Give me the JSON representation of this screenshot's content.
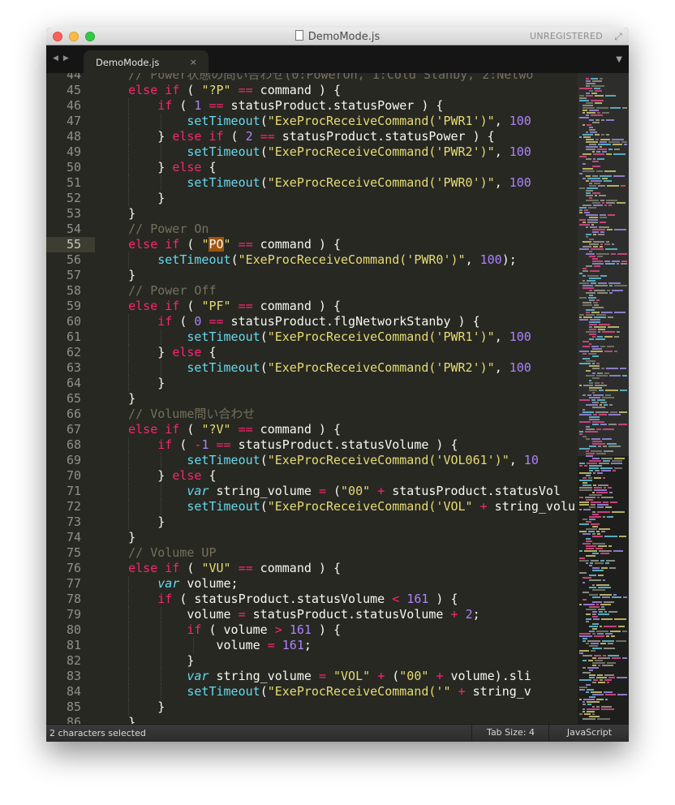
{
  "window": {
    "title": "DemoMode.js",
    "registration": "UNREGISTERED"
  },
  "tabs": [
    {
      "label": "DemoMode.js",
      "close": "×"
    }
  ],
  "icons": {
    "nav_back": "◀",
    "nav_forward": "▶",
    "tab_list": "▼",
    "fullscreen": "⤢"
  },
  "editor": {
    "current_line": 55,
    "lines": [
      {
        "n": 44,
        "t": [
          [
            "cm",
            "    // Power状態の問い合わせ(0:PowerOn, 1:Cold Stanby, 2:Netwo"
          ]
        ]
      },
      {
        "n": 45,
        "t": [
          [
            "",
            "    "
          ],
          [
            "kw",
            "else if"
          ],
          [
            "",
            " ( "
          ],
          [
            "st",
            "\"?P\""
          ],
          [
            "",
            " "
          ],
          [
            "kw",
            "=="
          ],
          [
            "",
            " command ) {"
          ]
        ]
      },
      {
        "n": 46,
        "t": [
          [
            "",
            "        "
          ],
          [
            "kw",
            "if"
          ],
          [
            "",
            " ( "
          ],
          [
            "nu",
            "1"
          ],
          [
            "",
            " "
          ],
          [
            "kw",
            "=="
          ],
          [
            "",
            " statusProduct.statusPower ) {"
          ]
        ]
      },
      {
        "n": 47,
        "t": [
          [
            "",
            "            "
          ],
          [
            "fn",
            "setTimeout"
          ],
          [
            "",
            "("
          ],
          [
            "st",
            "\"ExeProcReceiveCommand('PWR1')\""
          ],
          [
            "",
            ", "
          ],
          [
            "nu",
            "100"
          ]
        ]
      },
      {
        "n": 48,
        "t": [
          [
            "",
            "        } "
          ],
          [
            "kw",
            "else if"
          ],
          [
            "",
            " ( "
          ],
          [
            "nu",
            "2"
          ],
          [
            "",
            " "
          ],
          [
            "kw",
            "=="
          ],
          [
            "",
            " statusProduct.statusPower ) {"
          ]
        ]
      },
      {
        "n": 49,
        "t": [
          [
            "",
            "            "
          ],
          [
            "fn",
            "setTimeout"
          ],
          [
            "",
            "("
          ],
          [
            "st",
            "\"ExeProcReceiveCommand('PWR2')\""
          ],
          [
            "",
            ", "
          ],
          [
            "nu",
            "100"
          ]
        ]
      },
      {
        "n": 50,
        "t": [
          [
            "",
            "        } "
          ],
          [
            "kw",
            "else"
          ],
          [
            "",
            " {"
          ]
        ]
      },
      {
        "n": 51,
        "t": [
          [
            "",
            "            "
          ],
          [
            "fn",
            "setTimeout"
          ],
          [
            "",
            "("
          ],
          [
            "st",
            "\"ExeProcReceiveCommand('PWR0')\""
          ],
          [
            "",
            ", "
          ],
          [
            "nu",
            "100"
          ]
        ]
      },
      {
        "n": 52,
        "t": [
          [
            "",
            "        }"
          ]
        ]
      },
      {
        "n": 53,
        "t": [
          [
            "",
            "    }"
          ]
        ]
      },
      {
        "n": 54,
        "t": [
          [
            "cm",
            "    // Power On"
          ]
        ]
      },
      {
        "n": 55,
        "t": [
          [
            "",
            "    "
          ],
          [
            "kw",
            "else if"
          ],
          [
            "",
            " ( "
          ],
          [
            "st",
            "\""
          ],
          [
            "sel",
            "PO"
          ],
          [
            "st",
            "\""
          ],
          [
            "",
            " "
          ],
          [
            "kw",
            "=="
          ],
          [
            "",
            " command ) {"
          ]
        ]
      },
      {
        "n": 56,
        "t": [
          [
            "",
            "        "
          ],
          [
            "fn",
            "setTimeout"
          ],
          [
            "",
            "("
          ],
          [
            "st",
            "\"ExeProcReceiveCommand('PWR0')\""
          ],
          [
            "",
            ", "
          ],
          [
            "nu",
            "100"
          ],
          [
            "",
            ");"
          ]
        ]
      },
      {
        "n": 57,
        "t": [
          [
            "",
            "    }"
          ]
        ]
      },
      {
        "n": 58,
        "t": [
          [
            "cm",
            "    // Power Off"
          ]
        ]
      },
      {
        "n": 59,
        "t": [
          [
            "",
            "    "
          ],
          [
            "kw",
            "else if"
          ],
          [
            "",
            " ( "
          ],
          [
            "st",
            "\"PF\""
          ],
          [
            "",
            " "
          ],
          [
            "kw",
            "=="
          ],
          [
            "",
            " command ) {"
          ]
        ]
      },
      {
        "n": 60,
        "t": [
          [
            "",
            "        "
          ],
          [
            "kw",
            "if"
          ],
          [
            "",
            " ( "
          ],
          [
            "nu",
            "0"
          ],
          [
            "",
            " "
          ],
          [
            "kw",
            "=="
          ],
          [
            "",
            " statusProduct.flgNetworkStanby ) {"
          ]
        ]
      },
      {
        "n": 61,
        "t": [
          [
            "",
            "            "
          ],
          [
            "fn",
            "setTimeout"
          ],
          [
            "",
            "("
          ],
          [
            "st",
            "\"ExeProcReceiveCommand('PWR1')\""
          ],
          [
            "",
            ", "
          ],
          [
            "nu",
            "100"
          ]
        ]
      },
      {
        "n": 62,
        "t": [
          [
            "",
            "        } "
          ],
          [
            "kw",
            "else"
          ],
          [
            "",
            " {"
          ]
        ]
      },
      {
        "n": 63,
        "t": [
          [
            "",
            "            "
          ],
          [
            "fn",
            "setTimeout"
          ],
          [
            "",
            "("
          ],
          [
            "st",
            "\"ExeProcReceiveCommand('PWR2')\""
          ],
          [
            "",
            ", "
          ],
          [
            "nu",
            "100"
          ]
        ]
      },
      {
        "n": 64,
        "t": [
          [
            "",
            "        }"
          ]
        ]
      },
      {
        "n": 65,
        "t": [
          [
            "",
            "    }"
          ]
        ]
      },
      {
        "n": 66,
        "t": [
          [
            "cm",
            "    // Volume問い合わせ"
          ]
        ]
      },
      {
        "n": 67,
        "t": [
          [
            "",
            "    "
          ],
          [
            "kw",
            "else if"
          ],
          [
            "",
            " ( "
          ],
          [
            "st",
            "\"?V\""
          ],
          [
            "",
            " "
          ],
          [
            "kw",
            "=="
          ],
          [
            "",
            " command ) {"
          ]
        ]
      },
      {
        "n": 68,
        "t": [
          [
            "",
            "        "
          ],
          [
            "kw",
            "if"
          ],
          [
            "",
            " ( "
          ],
          [
            "kw",
            "-"
          ],
          [
            "nu",
            "1"
          ],
          [
            "",
            " "
          ],
          [
            "kw",
            "=="
          ],
          [
            "",
            " statusProduct.statusVolume ) {"
          ]
        ]
      },
      {
        "n": 69,
        "t": [
          [
            "",
            "            "
          ],
          [
            "fn",
            "setTimeout"
          ],
          [
            "",
            "("
          ],
          [
            "st",
            "\"ExeProcReceiveCommand('VOL061')\""
          ],
          [
            "",
            ", "
          ],
          [
            "nu",
            "10"
          ]
        ]
      },
      {
        "n": 70,
        "t": [
          [
            "",
            "        } "
          ],
          [
            "kw",
            "else"
          ],
          [
            "",
            " {"
          ]
        ]
      },
      {
        "n": 71,
        "t": [
          [
            "",
            "            "
          ],
          [
            "sv",
            "var"
          ],
          [
            "",
            " string_volume "
          ],
          [
            "kw",
            "="
          ],
          [
            "",
            " ("
          ],
          [
            "st",
            "\"00\""
          ],
          [
            "",
            " "
          ],
          [
            "kw",
            "+"
          ],
          [
            "",
            " statusProduct.statusVol"
          ]
        ]
      },
      {
        "n": 72,
        "t": [
          [
            "",
            "            "
          ],
          [
            "fn",
            "setTimeout"
          ],
          [
            "",
            "("
          ],
          [
            "st",
            "\"ExeProcReceiveCommand('VOL\""
          ],
          [
            "",
            " "
          ],
          [
            "kw",
            "+"
          ],
          [
            "",
            " string_volu"
          ]
        ]
      },
      {
        "n": 73,
        "t": [
          [
            "",
            "        }"
          ]
        ]
      },
      {
        "n": 74,
        "t": [
          [
            "",
            "    }"
          ]
        ]
      },
      {
        "n": 75,
        "t": [
          [
            "cm",
            "    // Volume UP"
          ]
        ]
      },
      {
        "n": 76,
        "t": [
          [
            "",
            "    "
          ],
          [
            "kw",
            "else if"
          ],
          [
            "",
            " ( "
          ],
          [
            "st",
            "\"VU\""
          ],
          [
            "",
            " "
          ],
          [
            "kw",
            "=="
          ],
          [
            "",
            " command ) {"
          ]
        ]
      },
      {
        "n": 77,
        "t": [
          [
            "",
            "        "
          ],
          [
            "sv",
            "var"
          ],
          [
            "",
            " volume;"
          ]
        ]
      },
      {
        "n": 78,
        "t": [
          [
            "",
            "        "
          ],
          [
            "kw",
            "if"
          ],
          [
            "",
            " ( statusProduct.statusVolume "
          ],
          [
            "kw",
            "<"
          ],
          [
            "",
            " "
          ],
          [
            "nu",
            "161"
          ],
          [
            "",
            " ) {"
          ]
        ]
      },
      {
        "n": 79,
        "t": [
          [
            "",
            "            volume "
          ],
          [
            "kw",
            "="
          ],
          [
            "",
            " statusProduct.statusVolume "
          ],
          [
            "kw",
            "+"
          ],
          [
            "",
            " "
          ],
          [
            "nu",
            "2"
          ],
          [
            "",
            ";"
          ]
        ]
      },
      {
        "n": 80,
        "t": [
          [
            "",
            "            "
          ],
          [
            "kw",
            "if"
          ],
          [
            "",
            " ( volume "
          ],
          [
            "kw",
            ">"
          ],
          [
            "",
            " "
          ],
          [
            "nu",
            "161"
          ],
          [
            "",
            " ) {"
          ]
        ]
      },
      {
        "n": 81,
        "t": [
          [
            "",
            "                volume "
          ],
          [
            "kw",
            "="
          ],
          [
            "",
            " "
          ],
          [
            "nu",
            "161"
          ],
          [
            "",
            ";"
          ]
        ]
      },
      {
        "n": 82,
        "t": [
          [
            "",
            "            }"
          ]
        ]
      },
      {
        "n": 83,
        "t": [
          [
            "",
            "            "
          ],
          [
            "sv",
            "var"
          ],
          [
            "",
            " string_volume "
          ],
          [
            "kw",
            "="
          ],
          [
            "",
            " "
          ],
          [
            "st",
            "\"VOL\""
          ],
          [
            "",
            " "
          ],
          [
            "kw",
            "+"
          ],
          [
            "",
            " ("
          ],
          [
            "st",
            "\"00\""
          ],
          [
            "",
            " "
          ],
          [
            "kw",
            "+"
          ],
          [
            "",
            " volume).sli"
          ]
        ]
      },
      {
        "n": 84,
        "t": [
          [
            "",
            "            "
          ],
          [
            "fn",
            "setTimeout"
          ],
          [
            "",
            "("
          ],
          [
            "st",
            "\"ExeProcReceiveCommand('\""
          ],
          [
            "",
            " "
          ],
          [
            "kw",
            "+"
          ],
          [
            "",
            " string_v"
          ]
        ]
      },
      {
        "n": 85,
        "t": [
          [
            "",
            "        }"
          ]
        ]
      },
      {
        "n": 86,
        "t": [
          [
            "",
            "    }"
          ]
        ]
      }
    ]
  },
  "status": {
    "selection": "2 characters selected",
    "tab_size": "Tab Size: 4",
    "syntax": "JavaScript"
  },
  "theme": {
    "background": "#272822",
    "keyword": "#f92672",
    "string": "#e6db74",
    "number": "#ae81ff",
    "function": "#66d9ef",
    "comment": "#75715e",
    "selection": "#9d550f"
  }
}
